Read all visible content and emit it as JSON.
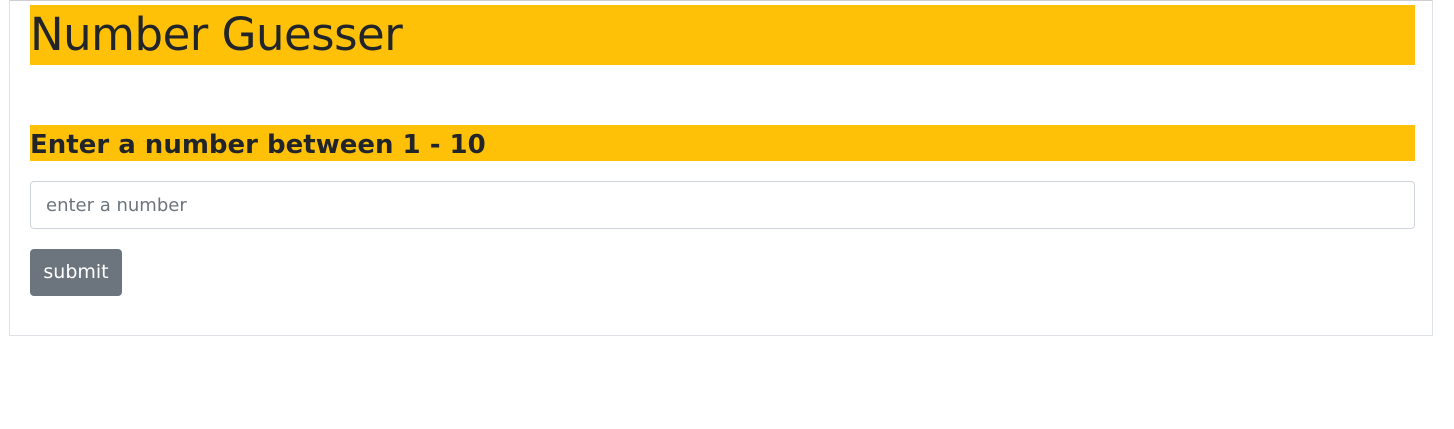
{
  "header": {
    "title": "Number Guesser"
  },
  "game": {
    "prompt": "Enter a number between 1 - 10",
    "input": {
      "value": "",
      "placeholder": "enter a number"
    },
    "submit_label": "submit"
  },
  "colors": {
    "highlight": "#ffc107",
    "button": "#6c757d",
    "card_border": "#dee2e6"
  }
}
